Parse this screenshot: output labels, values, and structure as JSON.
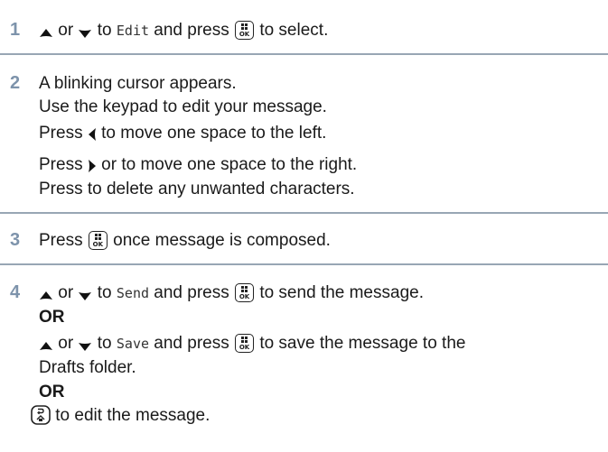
{
  "steps": [
    {
      "number": "1",
      "line1": {
        "or": "or",
        "to": "to",
        "option": "Edit",
        "and_press": "and press",
        "rest": "to select."
      }
    },
    {
      "number": "2",
      "line1": "A blinking cursor appears.",
      "line2": "Use the keypad to edit your message.",
      "line3": {
        "press": "Press",
        "rest": "to move one space to the left."
      },
      "line4": {
        "press": "Press",
        "rest": "or  to move one space to the right."
      },
      "line5": "Press  to delete any unwanted characters."
    },
    {
      "number": "3",
      "line1": {
        "press": "Press",
        "rest": "once message is composed."
      }
    },
    {
      "number": "4",
      "line1": {
        "or": "or",
        "to": "to",
        "option": "Send",
        "and_press": "and press",
        "rest": "to send the message."
      },
      "or1": "OR",
      "line2": {
        "or": "or",
        "to": "to",
        "option": "Save",
        "and_press": "and press",
        "rest": "to save the message to the"
      },
      "line3": "Drafts folder.",
      "or2": "OR",
      "line4": "to edit the message."
    }
  ],
  "icons": {
    "up": "up-arrow-icon",
    "down": "down-arrow-icon",
    "left": "left-arrow-icon",
    "right": "right-arrow-icon",
    "ok": "ok-key-icon",
    "back": "back-key-icon",
    "ok_label": "OK"
  },
  "colors": {
    "step_number": "#7d93ab",
    "divider": "#98a6b4"
  }
}
